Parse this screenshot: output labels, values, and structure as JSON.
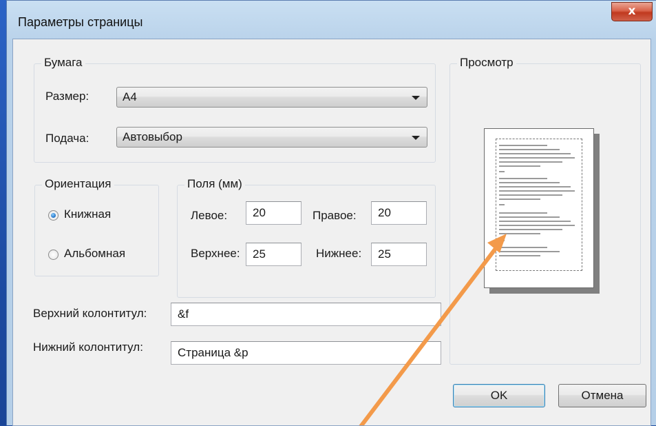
{
  "window": {
    "title": "Параметры страницы",
    "close_label": "x"
  },
  "paper": {
    "legend": "Бумага",
    "size_label": "Размер:",
    "size_value": "A4",
    "source_label": "Подача:",
    "source_value": "Автовыбор"
  },
  "orientation": {
    "legend": "Ориентация",
    "portrait_label": "Книжная",
    "landscape_label": "Альбомная",
    "selected": "portrait"
  },
  "margins": {
    "legend": "Поля (мм)",
    "left_label": "Левое:",
    "left_value": "20",
    "right_label": "Правое:",
    "right_value": "20",
    "top_label": "Верхнее:",
    "top_value": "25",
    "bottom_label": "Нижнее:",
    "bottom_value": "25"
  },
  "header_footer": {
    "header_label": "Верхний колонтитул:",
    "header_value": "&f",
    "footer_label": "Нижний колонтитул:",
    "footer_value": "Страница &p"
  },
  "preview": {
    "legend": "Просмотр"
  },
  "buttons": {
    "ok_label": "OK",
    "cancel_label": "Отмена"
  },
  "colors": {
    "desktop": "#1d4a9e",
    "dialog_face": "#f0f0f0",
    "close_button": "#c94a33",
    "annotation_arrow": "#f39a4a"
  },
  "icons": {
    "close": "close-icon",
    "dropdown": "chevron-down-icon",
    "annotation": "arrow-icon"
  }
}
